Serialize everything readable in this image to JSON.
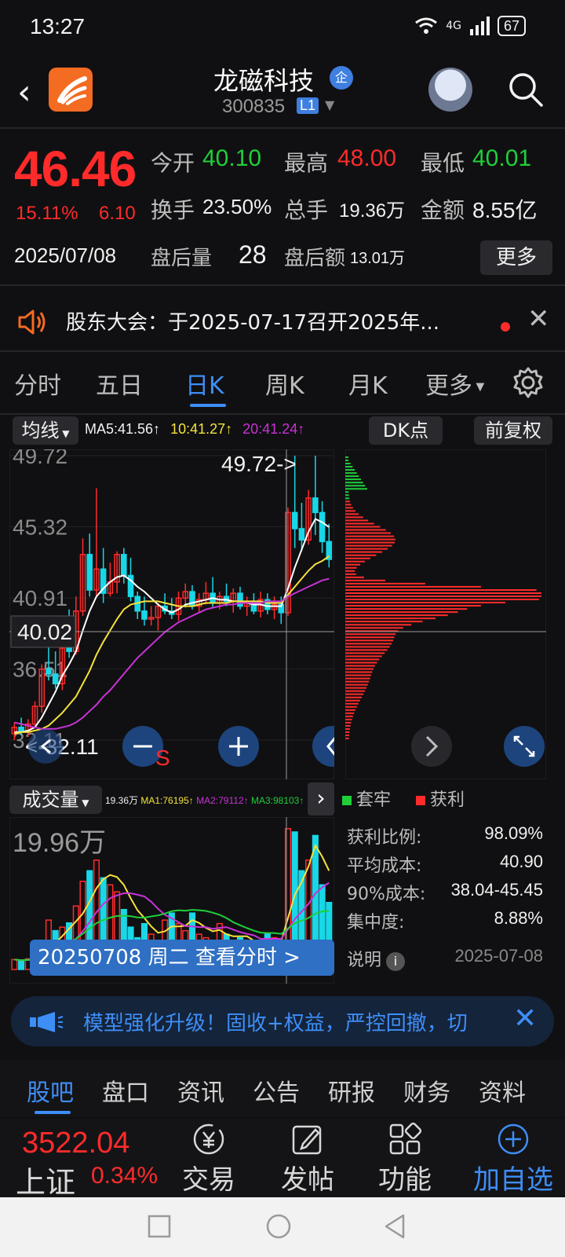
{
  "status": {
    "time": "13:27",
    "network": "4G",
    "battery": "67"
  },
  "header": {
    "back_icon": "chevron-left-icon",
    "stock_name": "龙磁科技",
    "badge": "企",
    "code": "300835",
    "level": "L1"
  },
  "quote": {
    "price": "46.46",
    "pct": "15.11%",
    "change": "6.10",
    "date": "2025/07/08",
    "open_label": "今开",
    "open": "40.10",
    "high_label": "最高",
    "high": "48.00",
    "low_label": "最低",
    "low": "40.01",
    "turnover_label": "换手",
    "turnover": "23.50%",
    "volume_label": "总手",
    "volume": "19.36万",
    "amount_label": "金额",
    "amount": "8.55亿",
    "after_vol_label": "盘后量",
    "after_vol": "28",
    "after_amt_label": "盘后额",
    "after_amt": "13.01万",
    "more_label": "更多"
  },
  "notice": {
    "text": "股东大会：于2025-07-17召开2025年..."
  },
  "period_tabs": [
    "分时",
    "五日",
    "日K",
    "周K",
    "月K",
    "更多"
  ],
  "chart_header": {
    "ma_label": "均线",
    "ma5": "MA5:41.56↑",
    "ma10": "10:41.27↑",
    "ma20": "20:41.24↑",
    "dk_label": "DK点",
    "adjust_label": "前复权"
  },
  "kline": {
    "y_labels": [
      "49.72",
      "45.32",
      "40.91",
      "36.51",
      "32.11"
    ],
    "crosshair_value": "40.02",
    "max_label": "49.72->",
    "min_label": "<-32.11",
    "sell_marker": "S",
    "colors": {
      "up": "#ff2b2b",
      "down": "#19d7e6",
      "ma5": "#ffffff",
      "ma10": "#f5e23a",
      "ma20": "#c832d6"
    }
  },
  "chart_data": {
    "type": "candlestick",
    "ylim": [
      32.11,
      49.72
    ],
    "candles": [
      {
        "o": 32.5,
        "h": 33.2,
        "l": 32.11,
        "c": 32.9
      },
      {
        "o": 32.9,
        "h": 33.5,
        "l": 32.4,
        "c": 32.6
      },
      {
        "o": 32.6,
        "h": 33.4,
        "l": 32.3,
        "c": 33.1
      },
      {
        "o": 33.1,
        "h": 34.5,
        "l": 32.9,
        "c": 34.2
      },
      {
        "o": 34.2,
        "h": 36.8,
        "l": 33.8,
        "c": 36.5
      },
      {
        "o": 36.5,
        "h": 38.5,
        "l": 35.8,
        "c": 36.2
      },
      {
        "o": 36.2,
        "h": 37.6,
        "l": 35.3,
        "c": 35.6
      },
      {
        "o": 35.6,
        "h": 39.0,
        "l": 35.2,
        "c": 37.8
      },
      {
        "o": 37.8,
        "h": 40.2,
        "l": 37.2,
        "c": 37.6
      },
      {
        "o": 37.6,
        "h": 41.0,
        "l": 37.4,
        "c": 40.1
      },
      {
        "o": 40.1,
        "h": 44.6,
        "l": 39.8,
        "c": 43.6
      },
      {
        "o": 43.6,
        "h": 44.9,
        "l": 41.0,
        "c": 41.4
      },
      {
        "o": 41.4,
        "h": 47.7,
        "l": 41.0,
        "c": 42.7
      },
      {
        "o": 42.7,
        "h": 44.0,
        "l": 40.6,
        "c": 41.2
      },
      {
        "o": 41.2,
        "h": 43.1,
        "l": 41.0,
        "c": 41.9
      },
      {
        "o": 41.9,
        "h": 43.8,
        "l": 41.2,
        "c": 43.6
      },
      {
        "o": 43.6,
        "h": 44.0,
        "l": 41.8,
        "c": 42.3
      },
      {
        "o": 42.3,
        "h": 43.4,
        "l": 40.7,
        "c": 41.0
      },
      {
        "o": 41.0,
        "h": 41.3,
        "l": 39.6,
        "c": 40.1
      },
      {
        "o": 40.1,
        "h": 41.0,
        "l": 39.2,
        "c": 39.6
      },
      {
        "o": 39.6,
        "h": 40.4,
        "l": 39.2,
        "c": 39.7
      },
      {
        "o": 39.7,
        "h": 40.6,
        "l": 38.9,
        "c": 40.4
      },
      {
        "o": 40.4,
        "h": 41.2,
        "l": 39.9,
        "c": 40.1
      },
      {
        "o": 40.1,
        "h": 40.9,
        "l": 39.6,
        "c": 39.9
      },
      {
        "o": 39.9,
        "h": 41.3,
        "l": 39.5,
        "c": 40.9
      },
      {
        "o": 40.9,
        "h": 41.8,
        "l": 40.3,
        "c": 41.3
      },
      {
        "o": 41.3,
        "h": 41.7,
        "l": 40.2,
        "c": 40.4
      },
      {
        "o": 40.4,
        "h": 41.2,
        "l": 40.0,
        "c": 40.8
      },
      {
        "o": 40.8,
        "h": 41.9,
        "l": 40.5,
        "c": 41.2
      },
      {
        "o": 41.2,
        "h": 42.2,
        "l": 40.3,
        "c": 40.6
      },
      {
        "o": 40.6,
        "h": 41.3,
        "l": 40.2,
        "c": 41.0
      },
      {
        "o": 41.0,
        "h": 41.8,
        "l": 40.4,
        "c": 40.7
      },
      {
        "o": 40.7,
        "h": 41.5,
        "l": 40.0,
        "c": 41.2
      },
      {
        "o": 41.2,
        "h": 41.6,
        "l": 40.2,
        "c": 40.4
      },
      {
        "o": 40.4,
        "h": 41.0,
        "l": 39.8,
        "c": 40.6
      },
      {
        "o": 40.6,
        "h": 41.2,
        "l": 39.9,
        "c": 40.1
      },
      {
        "o": 40.1,
        "h": 41.3,
        "l": 39.7,
        "c": 40.8
      },
      {
        "o": 40.8,
        "h": 41.2,
        "l": 39.9,
        "c": 40.2
      },
      {
        "o": 40.2,
        "h": 41.0,
        "l": 39.6,
        "c": 40.5
      },
      {
        "o": 40.5,
        "h": 41.0,
        "l": 39.3,
        "c": 40.0
      },
      {
        "o": 40.0,
        "h": 46.5,
        "l": 39.8,
        "c": 46.2
      },
      {
        "o": 46.2,
        "h": 49.72,
        "l": 44.0,
        "c": 45.2
      },
      {
        "o": 45.2,
        "h": 46.8,
        "l": 43.8,
        "c": 44.5
      },
      {
        "o": 44.5,
        "h": 47.6,
        "l": 44.2,
        "c": 47.1
      },
      {
        "o": 47.1,
        "h": 49.72,
        "l": 44.8,
        "c": 46.2
      },
      {
        "o": 46.2,
        "h": 46.9,
        "l": 43.7,
        "c": 44.4
      },
      {
        "o": 44.4,
        "h": 45.5,
        "l": 42.8,
        "c": 43.3
      }
    ],
    "ma5": [
      32.6,
      32.6,
      32.7,
      32.9,
      33.5,
      34.3,
      35.1,
      36.1,
      36.8,
      37.6,
      38.9,
      40.1,
      41.0,
      41.5,
      41.9,
      42.2,
      42.3,
      42.0,
      41.6,
      41.3,
      40.9,
      40.5,
      40.2,
      40.0,
      40.2,
      40.5,
      40.6,
      40.7,
      40.8,
      40.9,
      40.8,
      40.8,
      40.7,
      40.7,
      40.6,
      40.5,
      40.5,
      40.4,
      40.4,
      40.4,
      41.5,
      42.8,
      43.9,
      45.0,
      45.8,
      45.6,
      45.3
    ],
    "ma10": [
      32.5,
      32.6,
      32.6,
      32.7,
      32.8,
      33.0,
      33.4,
      33.8,
      34.3,
      34.8,
      35.6,
      36.4,
      37.4,
      38.2,
      38.9,
      39.6,
      40.2,
      40.5,
      40.6,
      40.7,
      40.7,
      40.7,
      40.6,
      40.5,
      40.4,
      40.4,
      40.4,
      40.5,
      40.6,
      40.6,
      40.6,
      40.6,
      40.7,
      40.7,
      40.7,
      40.7,
      40.7,
      40.6,
      40.6,
      40.6,
      41.1,
      41.6,
      42.1,
      42.6,
      43.0,
      43.2,
      43.5
    ],
    "ma20": [
      33.2,
      33.1,
      33.0,
      32.9,
      32.8,
      32.8,
      32.8,
      32.9,
      33.0,
      33.2,
      33.5,
      33.9,
      34.3,
      34.8,
      35.2,
      35.7,
      36.2,
      36.7,
      37.2,
      37.6,
      38.0,
      38.4,
      38.8,
      39.1,
      39.4,
      39.6,
      39.8,
      40.0,
      40.2,
      40.3,
      40.4,
      40.5,
      40.5,
      40.6,
      40.6,
      40.6,
      40.6,
      40.7,
      40.7,
      40.7,
      41.0,
      41.2,
      41.4,
      41.6,
      41.8,
      42.0,
      42.1
    ],
    "volume": {
      "max_label": "19.96万",
      "values": [
        1.4,
        1.2,
        1.5,
        1.3,
        3.8,
        7.0,
        5.5,
        6.0,
        6.6,
        9.0,
        12.5,
        14.0,
        15.5,
        13.0,
        12.0,
        11.0,
        8.5,
        6.0,
        4.5,
        6.5,
        5.0,
        4.0,
        7.0,
        8.0,
        6.5,
        5.5,
        8.0,
        5.0,
        4.5,
        4.0,
        6.5,
        5.0,
        3.5,
        4.5,
        4.0,
        3.5,
        3.0,
        5.0,
        4.5,
        4.0,
        19.96,
        19.5,
        14.0,
        15.5,
        19.0,
        12.0,
        9.5
      ],
      "up": [
        true,
        false,
        true,
        false,
        true,
        true,
        false,
        true,
        false,
        true,
        true,
        false,
        true,
        false,
        true,
        true,
        false,
        false,
        false,
        false,
        true,
        false,
        true,
        false,
        true,
        true,
        false,
        true,
        true,
        false,
        true,
        false,
        true,
        false,
        true,
        false,
        true,
        false,
        true,
        false,
        true,
        false,
        false,
        true,
        false,
        false,
        false
      ]
    },
    "volume_ma": {
      "vol_label": "19.36万",
      "ma1": "MA1:76195↑",
      "ma2": "MA2:79112↑",
      "ma3": "MA3:98103↑",
      "colors": {
        "ma1": "#f5e23a",
        "ma2": "#c832d6",
        "ma3": "#1fcf3a"
      }
    },
    "dk_profile": {
      "note": "chip distribution bars",
      "levels": 90
    }
  },
  "dk_stats": {
    "trapped_label": "套牢",
    "profit_label": "获利",
    "rows": [
      {
        "label": "获利比例:",
        "value": "98.09%"
      },
      {
        "label": "平均成本:",
        "value": "40.90"
      },
      {
        "label": "90%成本:",
        "value": "38.04-45.45"
      },
      {
        "label": "集中度:",
        "value": "8.88%"
      }
    ],
    "note_label": "说明",
    "note_date": "2025-07-08"
  },
  "volume_header": {
    "label": "成交量"
  },
  "tooltip": {
    "text": "20250708 周二 查看分时 >"
  },
  "promo": {
    "text": "模型强化升级！固收+权益，严控回撤，切"
  },
  "content_tabs": [
    "股吧",
    "盘口",
    "资讯",
    "公告",
    "研报",
    "财务",
    "资料"
  ],
  "bottom": {
    "index_value": "3522.04",
    "index_name": "上证",
    "index_pct": "0.34%",
    "items": [
      {
        "label": "交易",
        "icon": "yen-icon"
      },
      {
        "label": "发帖",
        "icon": "edit-icon"
      },
      {
        "label": "功能",
        "icon": "grid-icon"
      },
      {
        "label": "加自选",
        "icon": "add-circle-icon"
      }
    ]
  }
}
